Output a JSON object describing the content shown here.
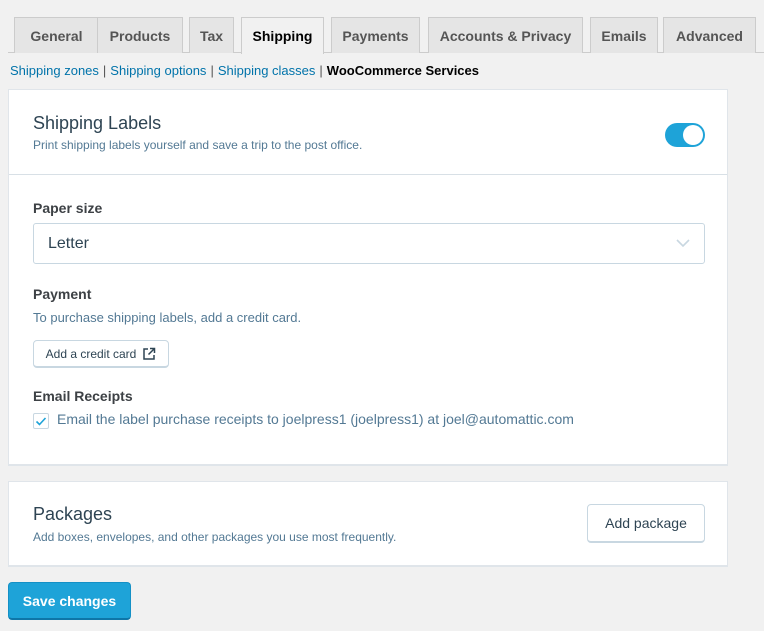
{
  "tabs": [
    {
      "label": "General",
      "active": false
    },
    {
      "label": "Products",
      "active": false
    },
    {
      "label": "Tax",
      "active": false
    },
    {
      "label": "Shipping",
      "active": true
    },
    {
      "label": "Payments",
      "active": false
    },
    {
      "label": "Accounts & Privacy",
      "active": false
    },
    {
      "label": "Emails",
      "active": false
    },
    {
      "label": "Advanced",
      "active": false
    }
  ],
  "subnav": {
    "links": [
      "Shipping zones",
      "Shipping options",
      "Shipping classes"
    ],
    "current": "WooCommerce Services",
    "separator": "|"
  },
  "shipping_labels": {
    "title": "Shipping Labels",
    "description": "Print shipping labels yourself and save a trip to the post office.",
    "enabled": true,
    "paper_size": {
      "label": "Paper size",
      "value": "Letter"
    },
    "payment": {
      "label": "Payment",
      "help": "To purchase shipping labels, add a credit card.",
      "button_label": "Add a credit card"
    },
    "email_receipts": {
      "label": "Email Receipts",
      "checked": true,
      "text": "Email the label purchase receipts to joelpress1 (joelpress1) at joel@automattic.com"
    }
  },
  "packages": {
    "title": "Packages",
    "description": "Add boxes, envelopes, and other packages you use most frequently.",
    "button_label": "Add package"
  },
  "save_button": "Save changes",
  "colors": {
    "accent": "#1ea3d8",
    "link": "#0073aa",
    "muted_text": "#537994"
  }
}
